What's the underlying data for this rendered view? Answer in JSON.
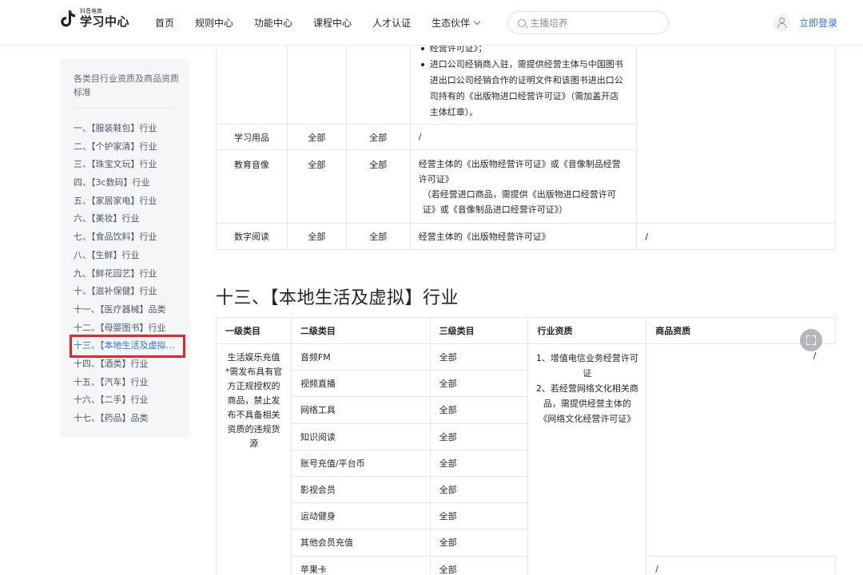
{
  "header": {
    "logo_small": "抖音电商",
    "logo_big": "学习中心",
    "nav": [
      "首页",
      "规则中心",
      "功能中心",
      "课程中心",
      "人才认证"
    ],
    "nav_dropdown": "生态伙伴",
    "search_placeholder": "主播培养",
    "login": "立即登录"
  },
  "sidebar": {
    "title": "各类目行业资质及商品资质标准",
    "items": [
      "一、【服装鞋包】行业",
      "二、【个护家清】行业",
      "三、【珠宝文玩】行业",
      "四、【3c数码】行业",
      "五、【家居家电】行业",
      "六、【美妆】行业",
      "七、【食品饮料】行业",
      "八、【生鲜】行业",
      "九、【鲜花园艺】行业",
      "十、【滋补保健】行业",
      "十一、【医疗器械】品类",
      "十二、【母婴图书】行业",
      "十三、【本地生活及虚拟】行业",
      "十四、【酒类】行业",
      "十五、【汽车】行业",
      "十六、【二手】行业",
      "十七、【药品】品类"
    ],
    "active_index": 12
  },
  "top_table": {
    "continued_bullets": [
      "经营许可证》；",
      "进口公司经销商入驻，需提供经营主体与中国图书进出口公司经销合作的证明文件和该图书进出口公司持有的《出版物进口经营许可证》（需加盖开店主体红章）。"
    ],
    "rows": [
      {
        "c1": "学习用品",
        "c2": "全部",
        "c3": "全部",
        "c4": "/",
        "c5": ""
      },
      {
        "c1": "教育音像",
        "c2": "全部",
        "c3": "全部",
        "c4a": "经营主体的《出版物经营许可证》或《音像制品经营许可证》",
        "c4b": "（若经营进口商品，需提供《出版物进口经营许可证》或《音像制品进口经营许可证》）",
        "c5": ""
      },
      {
        "c1": "数字阅读",
        "c2": "全部",
        "c3": "全部",
        "c4": "经营主体的《出版物经营许可证》",
        "c5": "/"
      }
    ]
  },
  "section_title": "十三、【本地生活及虚拟】行业",
  "bottom_table": {
    "headers": [
      "一级类目",
      "二级类目",
      "三级类目",
      "行业资质",
      "商品资质"
    ],
    "level1": "生活娱乐充值\n*需发布具有官方正规授权的商品，禁止发布不具备相关资质的违规货源",
    "industry_qual": "1、增值电信业务经营许可证\n2、若经营网络文化相关商品，需提供经营主体的《网络文化经营许可证》",
    "product_qual_1": "/",
    "product_qual_2": "/",
    "rows": [
      {
        "level2": "音频FM",
        "level3": "全部"
      },
      {
        "level2": "视频直播",
        "level3": "全部"
      },
      {
        "level2": "网络工具",
        "level3": "全部"
      },
      {
        "level2": "知识阅读",
        "level3": "全部"
      },
      {
        "level2": "账号充值/平台币",
        "level3": "全部"
      },
      {
        "level2": "影视会员",
        "level3": "全部"
      },
      {
        "level2": "运动健身",
        "level3": "全部"
      },
      {
        "level2": "其他会员充值",
        "level3": "全部"
      },
      {
        "level2": "苹果卡",
        "level3": "全部"
      }
    ]
  },
  "colors": {
    "accent": "#3370ff",
    "highlight_box": "#e4262d",
    "sidebar_bg": "#f5f6f7",
    "border": "#e4e5e7"
  },
  "icons": {
    "logo": "douyin-note-icon",
    "search": "search-icon",
    "user": "user-icon",
    "dropdown": "chevron-down-icon",
    "fullscreen": "fullscreen-icon"
  }
}
